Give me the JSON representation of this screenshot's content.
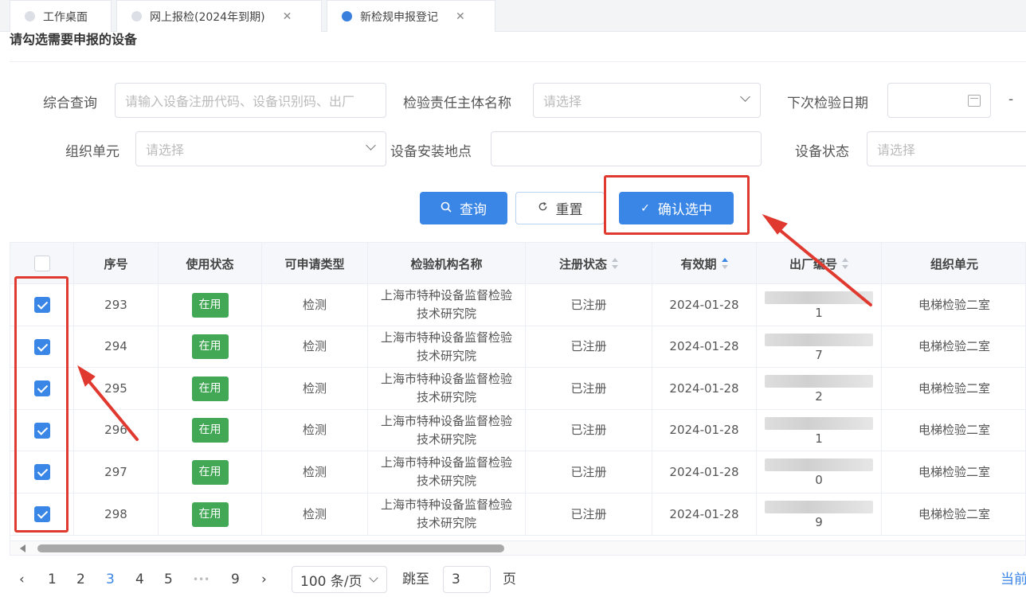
{
  "tabs": [
    {
      "label": "工作桌面",
      "closable": false,
      "active": false
    },
    {
      "label": "网上报检(2024年到期)",
      "closable": true,
      "active": false
    },
    {
      "label": "新检规申报登记",
      "closable": true,
      "active": true
    }
  ],
  "section_title": "请勾选需要申报的设备",
  "filters": {
    "general_query": {
      "label": "综合查询",
      "placeholder": "请输入设备注册代码、设备识别码、出厂"
    },
    "inspection_entity": {
      "label": "检验责任主体名称",
      "placeholder": "请选择"
    },
    "next_inspection_date": {
      "label": "下次检验日期",
      "separator": "-"
    },
    "org_unit": {
      "label": "组织单元",
      "placeholder": "请选择"
    },
    "install_location": {
      "label": "设备安装地点",
      "placeholder": ""
    },
    "device_status": {
      "label": "设备状态",
      "placeholder": "请选择"
    }
  },
  "buttons": {
    "query": "查询",
    "reset": "重置",
    "confirm": "确认选中"
  },
  "table": {
    "columns": [
      "序号",
      "使用状态",
      "可申请类型",
      "检验机构名称",
      "注册状态",
      "有效期",
      "出厂编号",
      "组织单元"
    ],
    "rows": [
      {
        "checked": true,
        "seq": "293",
        "status": "在用",
        "type": "检测",
        "org_l1": "上海市特种设备监督检验",
        "org_l2": "技术研究院",
        "reg": "已注册",
        "valid": "2024-01-28",
        "serial": "1",
        "unit": "电梯检验二室"
      },
      {
        "checked": true,
        "seq": "294",
        "status": "在用",
        "type": "检测",
        "org_l1": "上海市特种设备监督检验",
        "org_l2": "技术研究院",
        "reg": "已注册",
        "valid": "2024-01-28",
        "serial": "7",
        "unit": "电梯检验二室"
      },
      {
        "checked": true,
        "seq": "295",
        "status": "在用",
        "type": "检测",
        "org_l1": "上海市特种设备监督检验",
        "org_l2": "技术研究院",
        "reg": "已注册",
        "valid": "2024-01-28",
        "serial": "2",
        "unit": "电梯检验二室"
      },
      {
        "checked": true,
        "seq": "296",
        "status": "在用",
        "type": "检测",
        "org_l1": "上海市特种设备监督检验",
        "org_l2": "技术研究院",
        "reg": "已注册",
        "valid": "2024-01-28",
        "serial": "1",
        "unit": "电梯检验二室"
      },
      {
        "checked": true,
        "seq": "297",
        "status": "在用",
        "type": "检测",
        "org_l1": "上海市特种设备监督检验",
        "org_l2": "技术研究院",
        "reg": "已注册",
        "valid": "2024-01-28",
        "serial": "0",
        "unit": "电梯检验二室"
      },
      {
        "checked": true,
        "seq": "298",
        "status": "在用",
        "type": "检测",
        "org_l1": "上海市特种设备监督检验",
        "org_l2": "技术研究院",
        "reg": "已注册",
        "valid": "2024-01-28",
        "serial": "9",
        "unit": "电梯检验二室"
      }
    ]
  },
  "pagination": {
    "prev": "‹",
    "pages": [
      "1",
      "2",
      "3",
      "4",
      "5"
    ],
    "ellipsis": "•••",
    "last": "9",
    "next": "›",
    "current": "3",
    "page_size": "100 条/页",
    "jump_label": "跳至",
    "jump_value": "3",
    "page_unit": "页",
    "right_text": "当前"
  },
  "colors": {
    "primary": "#3a86e6",
    "status_green": "#43a856",
    "annotation_red": "#e0392f"
  }
}
